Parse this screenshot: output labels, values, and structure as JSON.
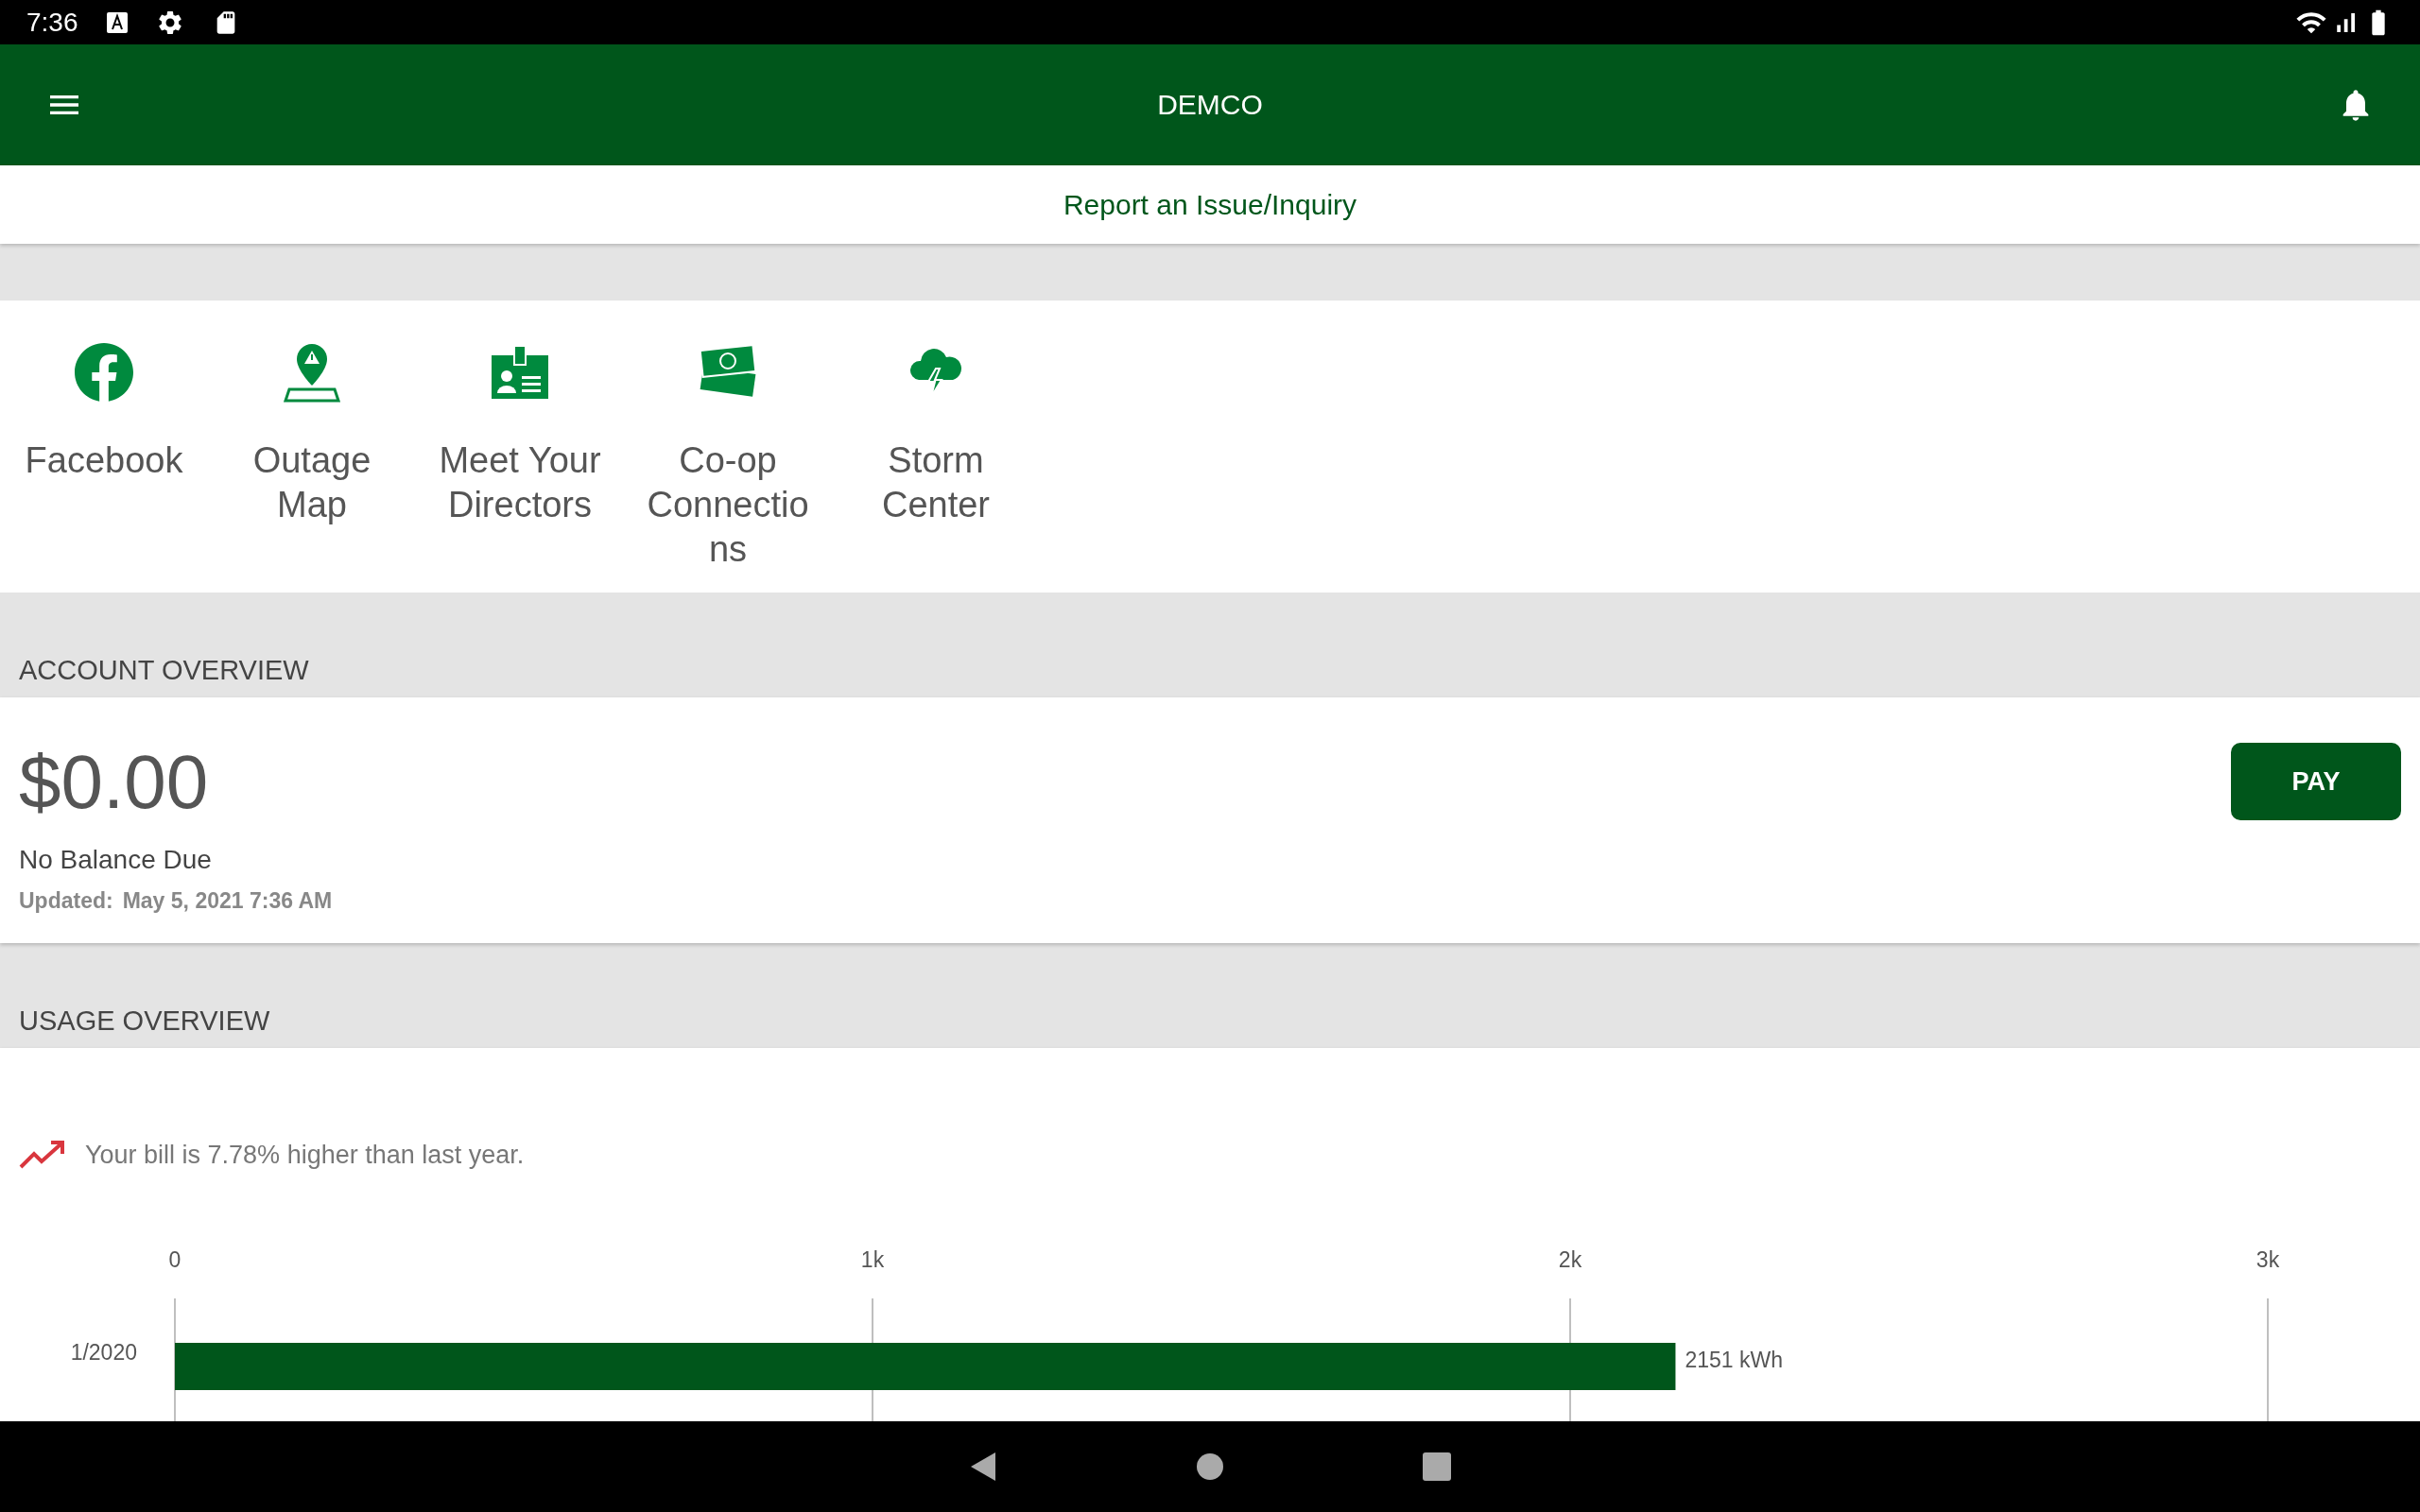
{
  "status_bar": {
    "time": "7:36"
  },
  "app_bar": {
    "title": "DEMCO"
  },
  "report_link": "Report an Issue/Inquiry",
  "shortcuts": [
    {
      "kind": "facebook",
      "label": "Facebook"
    },
    {
      "kind": "outage",
      "label": "Outage Map"
    },
    {
      "kind": "directors",
      "label": "Meet Your Directors"
    },
    {
      "kind": "money",
      "label": "Co-op Connectio ns"
    },
    {
      "kind": "storm",
      "label": "Storm Center"
    }
  ],
  "account": {
    "heading": "ACCOUNT OVERVIEW",
    "balance": "$0.00",
    "status": "No Balance Due",
    "updated_label": "Updated:",
    "updated_value": "May 5, 2021 7:36 AM",
    "pay_button": "PAY"
  },
  "usage": {
    "heading": "USAGE OVERVIEW",
    "trend": "Your bill is 7.78% higher than last year.",
    "chart_data": {
      "type": "bar",
      "orientation": "horizontal",
      "categories": [
        "1/2020"
      ],
      "series": [
        {
          "color": "#00561b",
          "values": [
            2151
          ]
        }
      ],
      "xlim": [
        0,
        3000
      ],
      "xticks": [
        0,
        {
          "value": 1000,
          "label": "1k"
        },
        {
          "value": 2000,
          "label": "2k"
        },
        {
          "value": 3000,
          "label": "3k"
        }
      ],
      "value_labels": [
        "2151 kWh"
      ]
    }
  }
}
